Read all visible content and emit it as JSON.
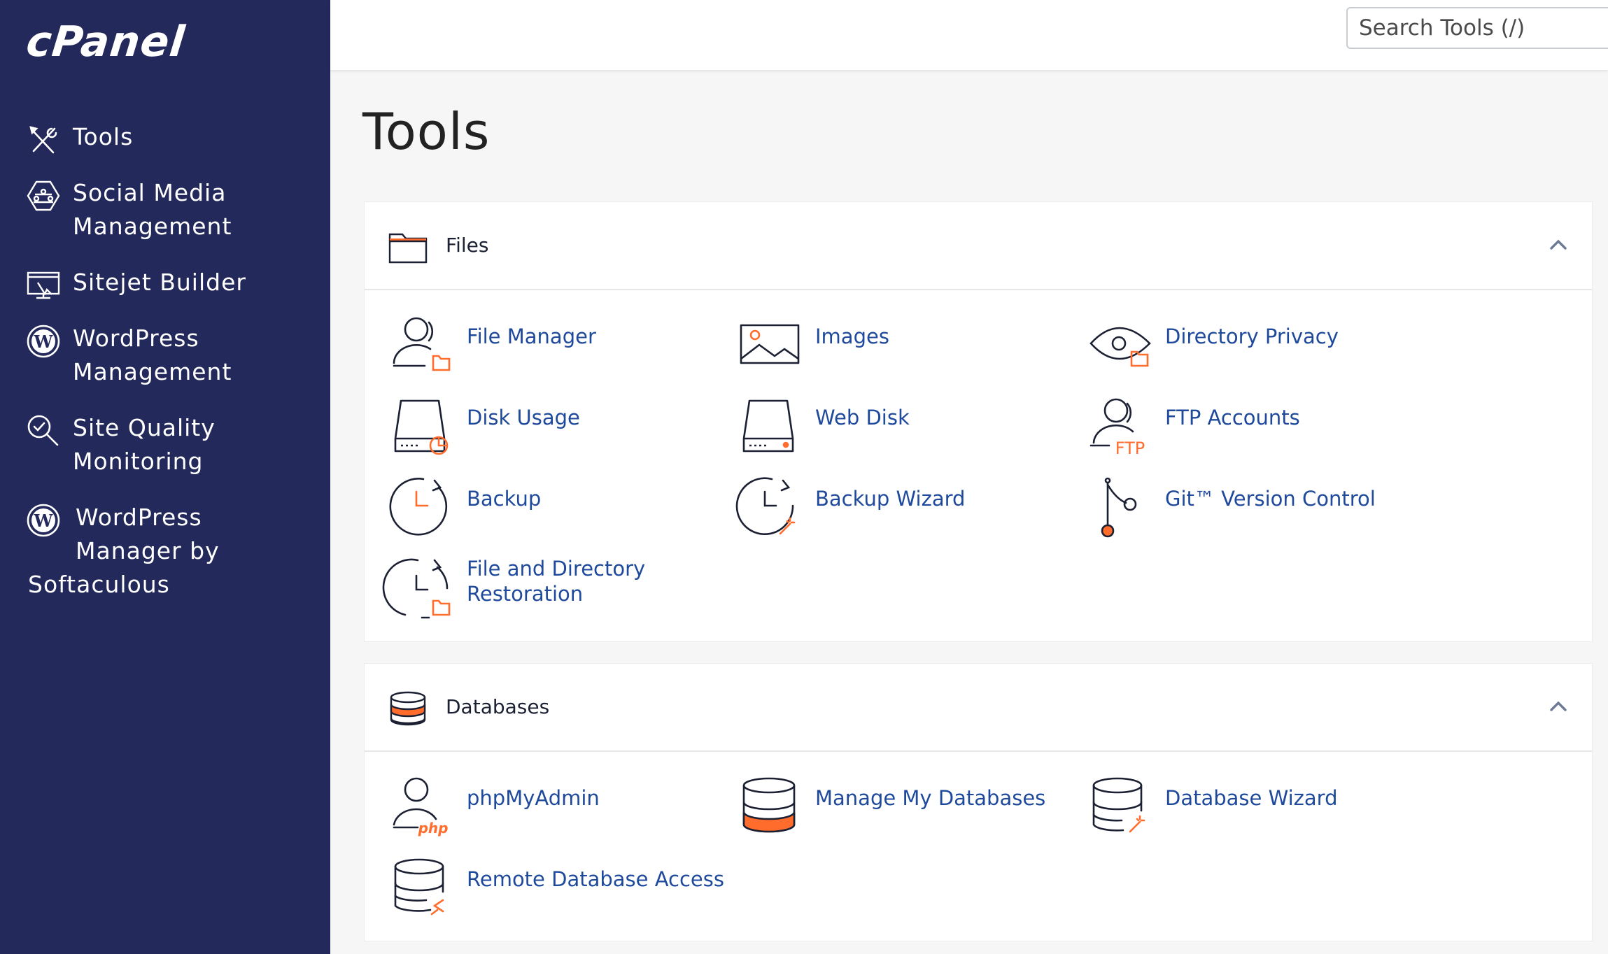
{
  "brand": {
    "logo_text": "cPanel"
  },
  "sidebar": {
    "items": [
      {
        "label": "Tools",
        "icon": "tools-icon"
      },
      {
        "label": "Social Media Management",
        "line1": "Social Media",
        "line2": "Management",
        "icon": "social-media-icon"
      },
      {
        "label": "Sitejet Builder",
        "icon": "sitejet-icon"
      },
      {
        "label": "WordPress Management",
        "line1": "WordPress",
        "line2": "Management",
        "icon": "wordpress-icon"
      },
      {
        "label": "Site Quality Monitoring",
        "line1": "Site Quality",
        "line2": "Monitoring",
        "icon": "site-quality-icon"
      },
      {
        "label": "WordPress Manager by Softaculous",
        "line1": "WordPress",
        "line2": "Manager by",
        "line3": "Softaculous",
        "icon": "wordpress-icon"
      }
    ]
  },
  "header": {
    "search_placeholder": "Search Tools (/)"
  },
  "page": {
    "title": "Tools"
  },
  "sections": [
    {
      "title": "Files",
      "icon": "folder-icon",
      "expanded": true,
      "tools": [
        {
          "label": "File Manager",
          "icon": "file-manager-icon"
        },
        {
          "label": "Images",
          "icon": "images-icon"
        },
        {
          "label": "Directory Privacy",
          "icon": "directory-privacy-icon"
        },
        {
          "label": "Disk Usage",
          "icon": "disk-usage-icon"
        },
        {
          "label": "Web Disk",
          "icon": "web-disk-icon"
        },
        {
          "label": "FTP Accounts",
          "icon": "ftp-accounts-icon"
        },
        {
          "label": "Backup",
          "icon": "backup-icon"
        },
        {
          "label": "Backup Wizard",
          "icon": "backup-wizard-icon"
        },
        {
          "label": "Git™ Version Control",
          "icon": "git-icon"
        },
        {
          "label": "File and Directory Restoration",
          "line1": "File and Directory",
          "line2": "Restoration",
          "icon": "restoration-icon"
        }
      ]
    },
    {
      "title": "Databases",
      "icon": "database-icon",
      "expanded": true,
      "tools": [
        {
          "label": "phpMyAdmin",
          "icon": "phpmyadmin-icon",
          "badge": "php"
        },
        {
          "label": "Manage My Databases",
          "icon": "manage-databases-icon"
        },
        {
          "label": "Database Wizard",
          "icon": "database-wizard-icon"
        },
        {
          "label": "Remote Database Access",
          "icon": "remote-database-icon"
        }
      ]
    }
  ],
  "ftp_badge": "FTP",
  "colors": {
    "sidebar": "#23295b",
    "link": "#1f4a9c",
    "accent": "#ff6c2c"
  }
}
